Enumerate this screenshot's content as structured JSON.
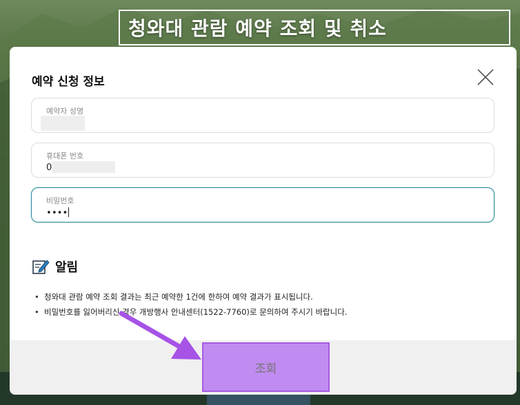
{
  "page": {
    "title": "청와대 관람 예약 조회 및 취소"
  },
  "modal": {
    "title": "예약 신청 정보",
    "fields": {
      "name": {
        "label": "예약자 성명",
        "value": ""
      },
      "phone": {
        "label": "휴대폰 번호",
        "value": "0"
      },
      "password": {
        "label": "비밀번호",
        "value": "••••"
      }
    },
    "notice": {
      "title": "알림",
      "items": [
        "청와대 관람 예약 조회 결과는 최근 예약한 1건에 한하여 예약 결과가 표시됩니다.",
        "비밀번호를 잃어버리신 경우 개방행사 안내센터(1522-7760)로 문의하여 주시기 바랍니다."
      ]
    },
    "buttons": {
      "search_label": "조회"
    }
  },
  "colors": {
    "focus_border": "#2b8a9a",
    "button_fill": "#c08cf1",
    "arrow": "#a653e6"
  },
  "icons": {
    "close": "close-icon",
    "notice": "memo-pencil-icon"
  }
}
